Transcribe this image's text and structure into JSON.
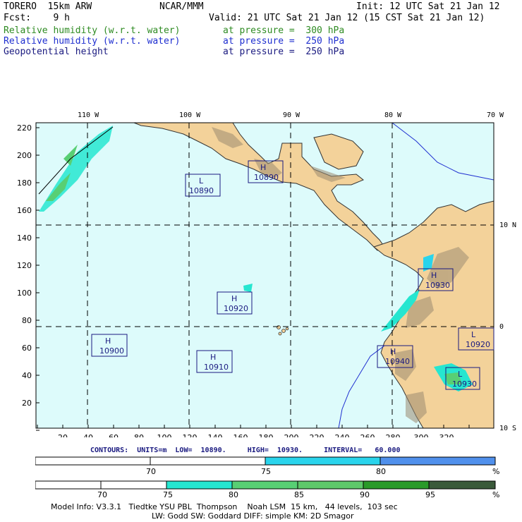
{
  "header": {
    "model": "TORERO  15km ARW",
    "org": "NCAR/MMM",
    "init": "Init: 12 UTC Sat 21 Jan 12",
    "fcst": "Fcst:    9 h",
    "valid": "Valid: 21 UTC Sat 21 Jan 12 (15 CST Sat 21 Jan 12)",
    "fields": [
      {
        "name": "Relative humidity (w.r.t. water)",
        "level": "at pressure =  300 hPa",
        "color": "#2e8b22"
      },
      {
        "name": "Relative humidity (w.r.t. water)",
        "level": "at pressure =  250 hPa",
        "color": "#1f2fd0"
      },
      {
        "name": "Geopotential height",
        "level": "at pressure =  250 hPa",
        "color": "#1a1a80"
      }
    ]
  },
  "map": {
    "top_lon_labels": [
      "110 W",
      "100 W",
      "90 W",
      "80 W",
      "70 W"
    ],
    "right_lat_labels": [
      "10 N",
      "0",
      "10 S"
    ],
    "left_ticks": [
      "220",
      "200",
      "180",
      "160",
      "140",
      "120",
      "100",
      "80",
      "60",
      "40",
      "20"
    ],
    "bottom_ticks": [
      "20",
      "40",
      "60",
      "80",
      "100",
      "120",
      "140",
      "160",
      "180",
      "200",
      "220",
      "240",
      "260",
      "280",
      "300",
      "320"
    ],
    "ocean_color": "#ddfbfb",
    "land_color": "#f3d29a",
    "highs_lows": [
      {
        "type": "L",
        "value": "10890"
      },
      {
        "type": "H",
        "value": "10890"
      },
      {
        "type": "H",
        "value": "10920"
      },
      {
        "type": "H",
        "value": "10900"
      },
      {
        "type": "H",
        "value": "10910"
      },
      {
        "type": "H",
        "value": "10930"
      },
      {
        "type": "H",
        "value": "10940"
      },
      {
        "type": "L",
        "value": "10920"
      },
      {
        "type": "L",
        "value": "10930"
      }
    ]
  },
  "contours_line": "CONTOURS:  UNITS=m  LOW=  10890.     HIGH=  10930.     INTERVAL=   60.000",
  "colorbar_250": {
    "labels": [
      "70",
      "75",
      "80"
    ],
    "unit": "%",
    "colors": [
      "#ffffff",
      "#ffffff",
      "#2ad4ec",
      "#5090ec"
    ]
  },
  "colorbar_300": {
    "labels": [
      "70",
      "75",
      "80",
      "85",
      "90",
      "95"
    ],
    "unit": "%",
    "colors": [
      "#ffffff",
      "#ffffff",
      "#ffffff",
      "#26e6d0",
      "#58cf74",
      "#5ec86a",
      "#2a9a2a",
      "#3a5a3a"
    ]
  },
  "footer": {
    "line1": "Model Info: V3.3.1   Tiedtke YSU PBL  Thompson    Noah LSM  15 km,   44 levels,  103 sec",
    "line2": "LW: Godd SW: Goddard DIFF: simple KM: 2D Smagor"
  }
}
